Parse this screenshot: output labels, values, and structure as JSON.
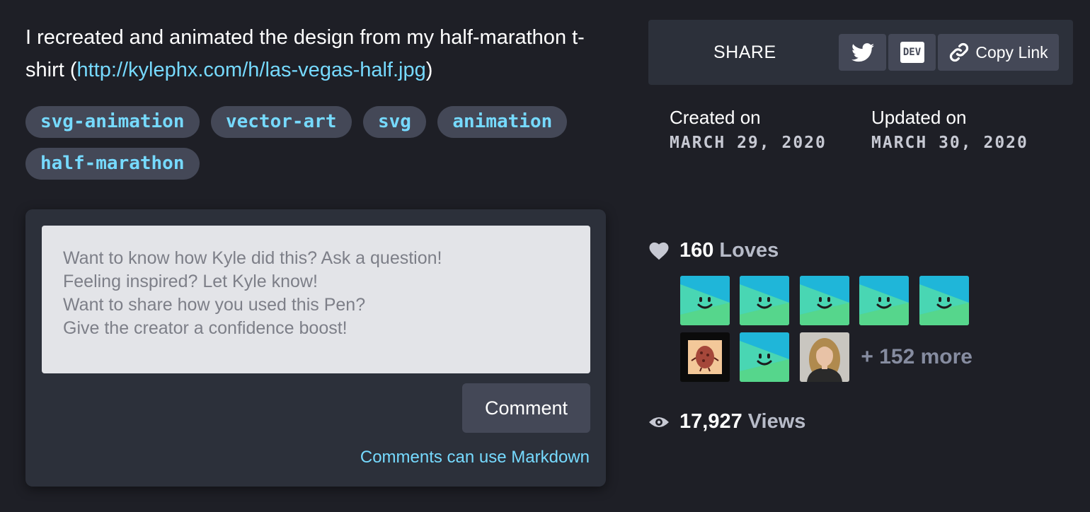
{
  "description": {
    "text": "I recreated and animated the design from my half-marathon t-shirt (",
    "link": "http://kylephx.com/h/las-vegas-half.jpg",
    "suffix": ")"
  },
  "tags": [
    "svg-animation",
    "vector-art",
    "svg",
    "animation",
    "half-marathon"
  ],
  "comment": {
    "placeholder": "Want to know how Kyle did this? Ask a question!\nFeeling inspired? Let Kyle know!\nWant to share how you used this Pen?\nGive the creator a confidence boost!",
    "button_label": "Comment",
    "markdown_note": "Comments can use Markdown"
  },
  "share": {
    "label": "SHARE",
    "twitter_icon": "twitter-icon",
    "dev_label": "DEV",
    "copy_link_label": "Copy Link"
  },
  "meta": {
    "created_label": "Created on",
    "created_date": "MARCH 29, 2020",
    "updated_label": "Updated on",
    "updated_date": "MARCH 30, 2020"
  },
  "loves": {
    "count": "160",
    "label": "Loves",
    "more": "+ 152 more"
  },
  "views": {
    "count": "17,927",
    "label": "Views"
  },
  "colors": {
    "background": "#1e1f26",
    "panel": "#2c303a",
    "button": "#444857",
    "link": "#76daff"
  }
}
